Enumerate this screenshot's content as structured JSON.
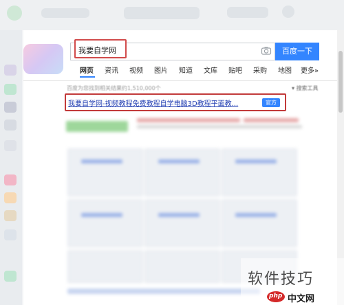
{
  "search": {
    "query": "我要自学网",
    "button_label": "百度一下"
  },
  "nav": {
    "tabs": [
      "网页",
      "资讯",
      "视频",
      "图片",
      "知道",
      "文库",
      "贴吧",
      "采购",
      "地图",
      "更多»"
    ],
    "active_index": 0
  },
  "results": {
    "count_text": "百度为您找到相关结果约1,510,000个",
    "tools_label": "搜索工具",
    "first_result": {
      "title": "我要自学网-视频教程免费教程自学电脑3D教程平面教...",
      "badge": "官方"
    }
  },
  "watermark": {
    "text": "软件技巧",
    "logo_php": "php",
    "logo_cn": "中文网"
  },
  "colors": {
    "accent": "#3385ff",
    "highlight_frame": "#c23a3a",
    "link": "#2440b3"
  }
}
